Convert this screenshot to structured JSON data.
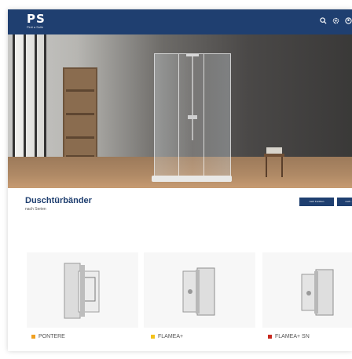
{
  "header": {
    "logo_text": "PS",
    "logo_tagline": "Pinti a Sulle",
    "brand_color": "#1f3f70"
  },
  "section": {
    "title": "Duschtürbänder",
    "subtitle": "nach Serien",
    "buttons": [
      {
        "label": "nach Funktion"
      },
      {
        "label": "nach..."
      }
    ]
  },
  "products": [
    {
      "name": "PONTERE",
      "marker_color": "#f0a020",
      "image_icon": "shower-hinge-icon"
    },
    {
      "name": "FLAMEA+",
      "marker_color": "#f4c21a",
      "image_icon": "shower-hinge-icon"
    },
    {
      "name": "FLAMEA+ SN",
      "marker_color": "#c8281e",
      "image_icon": "shower-hinge-icon"
    }
  ],
  "icons": {
    "header": [
      "search-icon",
      "gear-icon",
      "account-icon"
    ]
  }
}
